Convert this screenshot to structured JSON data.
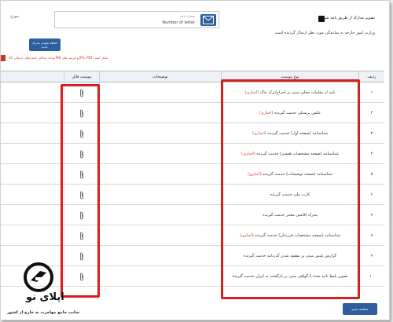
{
  "header": {
    "date_label": "مورخ",
    "letter_box_title": "شماره نامه",
    "letter_box_value": "Number of letter",
    "checkbox_label": "تصویر مدارک از طریق نامه شماره"
  },
  "notice": "وزارت امور خارجه به نمایندگی مورد نظر ارسال گردیده است",
  "add_button": "اضافه نمودن مدرک جدید",
  "warning": "توجه: حداکثر حجم فایل ارسالی 10 MB و فرمت های JPG, PDF مجاز است",
  "table": {
    "headers": {
      "row": "ردیف",
      "doc_type": "نوع پیوست",
      "description": "توضیحات",
      "attachment": "پیوست فایل"
    },
    "rows": [
      {
        "num": "۱",
        "doc": "نامه از مقامات محلی مبنی بر اخراج/ترک خاک",
        "req": "(اجباری)"
      },
      {
        "num": "۲",
        "doc": "عکس پرسنلی خدمت گیرنده",
        "req": "(اجباری)"
      },
      {
        "num": "۳",
        "doc": "شناسنامه (صفحه اول) خدمت گیرنده",
        "req": "(اجباری)"
      },
      {
        "num": "۴",
        "doc": "شناسنامه (صفحه مشخصات همسر) خدمت گیرنده",
        "req": "(اجباری)"
      },
      {
        "num": "۵",
        "doc": "شناسنامه (صفحه توضیحات) خدمت گیرنده",
        "req": "(اجباری)"
      },
      {
        "num": "۶",
        "doc": "کارت ملی خدمت گیرنده",
        "req": ""
      },
      {
        "num": "۷",
        "doc": "مدرک اقامتی معتبر خدمت گیرنده",
        "req": ""
      },
      {
        "num": "۸",
        "doc": "شناسنامه (صفحه مشخصات فرزندان) خدمت گیرنده",
        "req": "(اجباری)"
      },
      {
        "num": "۹",
        "doc": "گزارش پلیس مبنی بر مفقود شدن گذرنامه خدمت گیرنده",
        "req": ""
      },
      {
        "num": "۱۰",
        "doc": "تصویر بلیط تائید شده یا گواهی مبنی بر بازگشت به ایران خدمت گیرنده",
        "req": ""
      }
    ]
  },
  "submit_button": "مشاهده فرم",
  "logo": {
    "name": "اپلای نو",
    "tagline": "سایت جامع مهاجرت به خارج از کشور"
  },
  "colors": {
    "accent": "#2d5f9e",
    "highlight": "#d81e1e",
    "required": "#c0392b"
  }
}
